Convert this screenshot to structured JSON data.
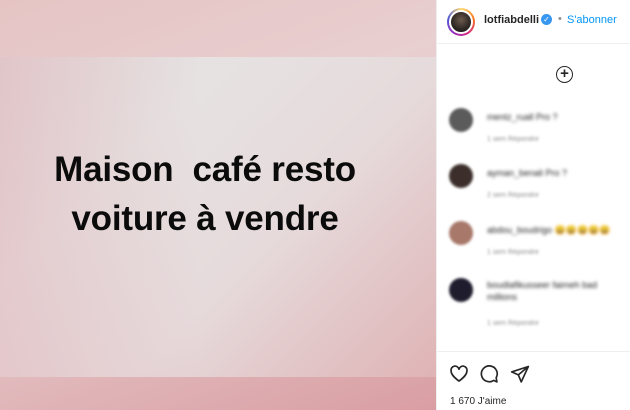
{
  "post": {
    "line1": "Maison  café resto",
    "line2": "voiture à vendre"
  },
  "header": {
    "username": "lotfiabdelli",
    "separator": "•",
    "follow_label": "S'abonner",
    "verified_glyph": "✓"
  },
  "add_icon_glyph": "+",
  "comments": [
    {
      "text": "mentz_ruall Pro ?",
      "meta": "1 sem    Répondre",
      "avatar_color": "#5b5b5b"
    },
    {
      "text": "ayman_benali Pro ?",
      "meta": "2 sem    Répondre",
      "avatar_color": "#3c2f2b"
    },
    {
      "text": "abdou_boudrigo 😀😀😀😀😀",
      "meta": "1 sem    Répondre",
      "avatar_color": "#a8786a"
    },
    {
      "text": "boudlafikusseer faimeh bad",
      "text2": "millions",
      "meta": "1 sem    Répondre",
      "avatar_color": "#1f1c2e"
    }
  ],
  "footer": {
    "likes": "1 670 J'aime",
    "icons": [
      "heart-icon",
      "comment-icon",
      "share-icon"
    ]
  }
}
